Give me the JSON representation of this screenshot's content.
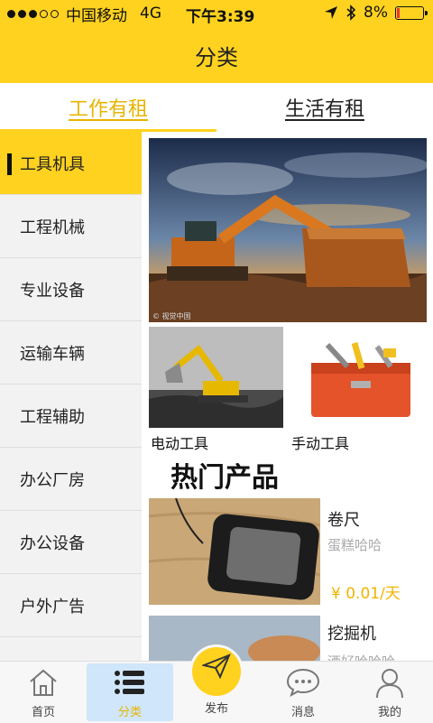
{
  "status_bar": {
    "carrier": "中国移动",
    "network": "4G",
    "time": "下午3:39",
    "battery": "8%"
  },
  "header": {
    "title": "分类"
  },
  "tabs": [
    {
      "label": "工作有租",
      "active": true
    },
    {
      "label": "生活有租",
      "active": false
    }
  ],
  "sidebar": {
    "items": [
      {
        "label": "工具机具",
        "active": true
      },
      {
        "label": "工程机械",
        "active": false
      },
      {
        "label": "专业设备",
        "active": false
      },
      {
        "label": "运输车辆",
        "active": false
      },
      {
        "label": "工程辅助",
        "active": false
      },
      {
        "label": "办公厂房",
        "active": false
      },
      {
        "label": "办公设备",
        "active": false
      },
      {
        "label": "户外广告",
        "active": false
      }
    ]
  },
  "content": {
    "categories": [
      {
        "label": "电动工具",
        "icon": "excavator-photo"
      },
      {
        "label": "手动工具",
        "icon": "toolbox-photo"
      }
    ],
    "section_title": "热门产品",
    "products": [
      {
        "name": "卷尺",
        "desc": "蛋糕哈哈",
        "price": "¥ 0.01/天"
      },
      {
        "name": "挖掘机",
        "desc": "酒好哈哈哈"
      }
    ]
  },
  "bottom_nav": {
    "items": [
      {
        "label": "首页",
        "icon": "home-icon",
        "active": false
      },
      {
        "label": "分类",
        "icon": "list-icon",
        "active": true
      },
      {
        "label": "发布",
        "icon": "paper-plane-icon",
        "active": false
      },
      {
        "label": "消息",
        "icon": "chat-icon",
        "active": false
      },
      {
        "label": "我的",
        "icon": "user-icon",
        "active": false
      }
    ]
  },
  "colors": {
    "accent": "#ffd21f",
    "accent_text": "#e7b400",
    "price": "#f0b400",
    "nav_active_bg": "#cfe6fb"
  }
}
